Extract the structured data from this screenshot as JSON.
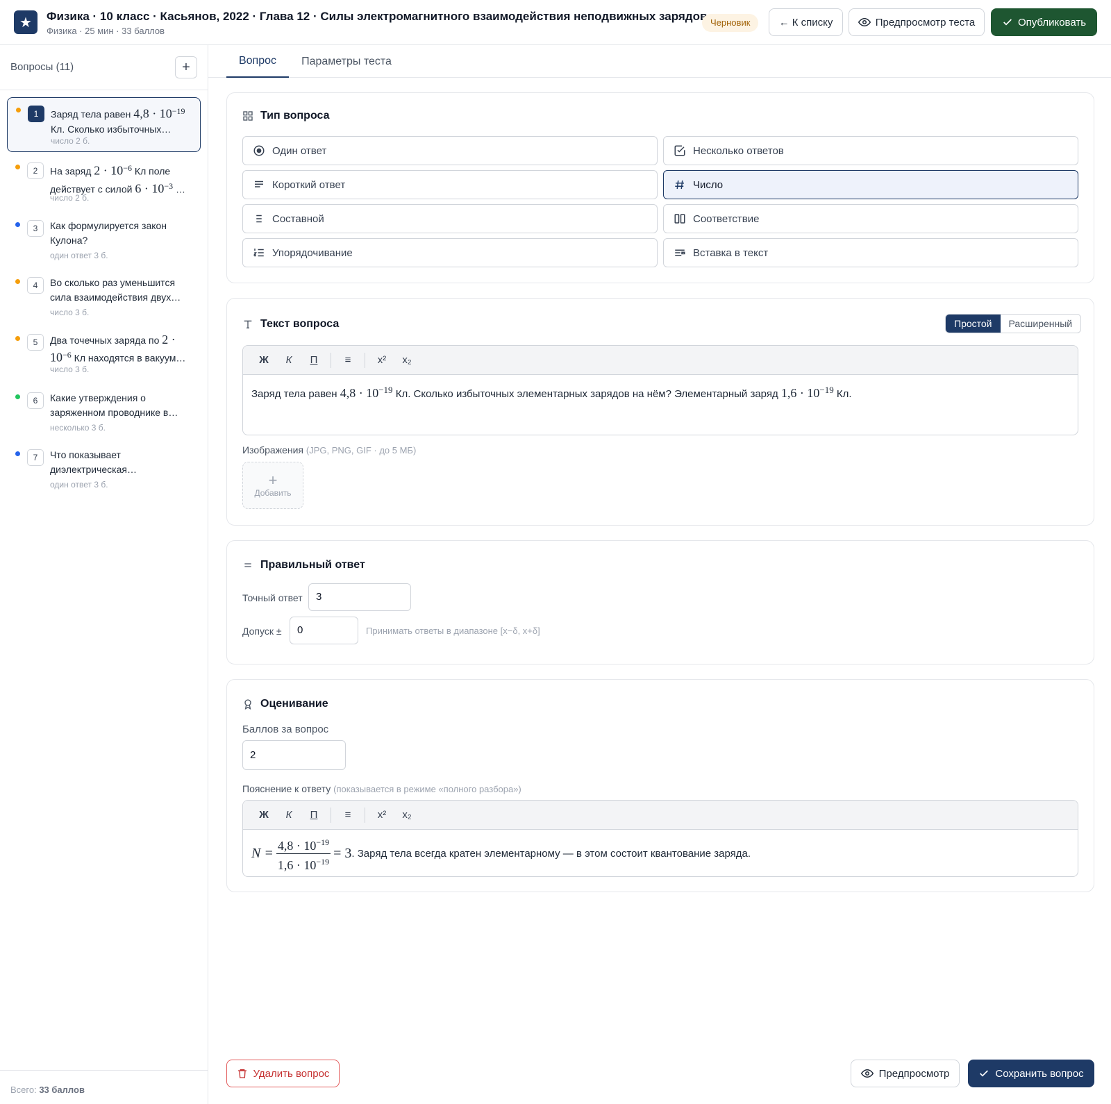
{
  "header": {
    "title": "Физика · 10 класс · Касьянов, 2022 · Глава 12 · Силы электромагнитного взаимодействия неподвижных зарядов",
    "subtitle": "Физика · 25 мин · 33 баллов",
    "status_badge": "Черновик",
    "back_label": "← К списку",
    "preview_label": "Предпросмотр теста",
    "publish_label": "Опубликовать"
  },
  "sidebar": {
    "heading": "Вопросы (11)",
    "add_label": "+",
    "items": [
      {
        "num": "1",
        "text_a": "Заряд тела равен ",
        "math": "4,8 · 10",
        "exp": "−19",
        "text_b": " Кл. Сколько избыточных…",
        "meta": "число  2 б.",
        "dot": "#f59e0b"
      },
      {
        "num": "2",
        "text_a": "На заряд ",
        "math": "2 · 10",
        "exp": "−6",
        "text_b": " Кл поле действует с силой ",
        "math2": "6 · 10",
        "exp2": "−3",
        "text_c": " …",
        "meta": "число  2 б.",
        "dot": "#f59e0b"
      },
      {
        "num": "3",
        "text": "Как формулируется закон Кулона?",
        "meta": "один ответ  3 б.",
        "dot": "#2563eb"
      },
      {
        "num": "4",
        "text": "Во сколько раз уменьшится сила взаимодействия двух…",
        "meta": "число  3 б.",
        "dot": "#f59e0b"
      },
      {
        "num": "5",
        "text_a": "Два точечных заряда по ",
        "math": "2 ·",
        "text_b": " ",
        "math2": "10",
        "exp2": "−6",
        "text_c": " Кл находятся в вакуум…",
        "meta": "число  3 б.",
        "dot": "#f59e0b"
      },
      {
        "num": "6",
        "text": "Какие утверждения о заряженном проводнике в…",
        "meta": "несколько  3 б.",
        "dot": "#22c55e"
      },
      {
        "num": "7",
        "text": "Что показывает диэлектрическая…",
        "meta": "один ответ  3 б.",
        "dot": "#2563eb"
      }
    ],
    "total_label": "Всего:",
    "total_value": "33 баллов"
  },
  "tabs": [
    "Вопрос",
    "Параметры теста"
  ],
  "question_type": {
    "title": "Тип вопроса",
    "options": [
      "Один ответ",
      "Несколько ответов",
      "Короткий ответ",
      "Число",
      "Составной",
      "Соответствие",
      "Упорядочивание",
      "Вставка в текст"
    ],
    "selected": "Число"
  },
  "question_text": {
    "title": "Текст вопроса",
    "mode_simple": "Простой",
    "mode_advanced": "Расширенный",
    "toolbar": [
      "Ж",
      "К",
      "П",
      "≡",
      "x²",
      "x₂"
    ],
    "body_a": "Заряд тела равен ",
    "body_m1": "4,8 · 10",
    "body_e1": "−19",
    "body_b": " Кл. Сколько избыточных элементарных зарядов на нём? Элементарный заряд ",
    "body_m2": "1,6 · 10",
    "body_e2": "−19",
    "body_c": " Кл.",
    "images_label": "Изображения",
    "images_hint": "(JPG, PNG, GIF · до 5 МБ)",
    "add_image_label": "Добавить"
  },
  "answer": {
    "title": "Правильный ответ",
    "exact_label": "Точный ответ",
    "exact_value": "3",
    "tolerance_label": "Допуск ±",
    "tolerance_value": "0",
    "tolerance_hint": "Принимать ответы в диапазоне [x−δ, x+δ]"
  },
  "grading": {
    "title": "Оценивание",
    "points_label": "Баллов за вопрос",
    "points_value": "2",
    "explanation_label": "Пояснение к ответу",
    "explanation_hint": "(показывается в режиме «полного разбора»)",
    "toolbar": [
      "Ж",
      "К",
      "П",
      "≡",
      "x²",
      "x₂"
    ],
    "formula_lhs": "N =",
    "formula_num": "4,8 · 10",
    "formula_num_exp": "−19",
    "formula_den": "1,6 · 10",
    "formula_den_exp": "−19",
    "formula_rhs": "= 3",
    "explanation_text": ". Заряд тела всегда кратен элементарному — в этом состоит квантование заряда."
  },
  "footer": {
    "delete_label": "Удалить вопрос",
    "preview_label": "Предпросмотр",
    "save_label": "Сохранить вопрос"
  },
  "colors": {
    "brand": "#1e3a66",
    "publish": "#1e5631",
    "danger": "#c53030"
  }
}
